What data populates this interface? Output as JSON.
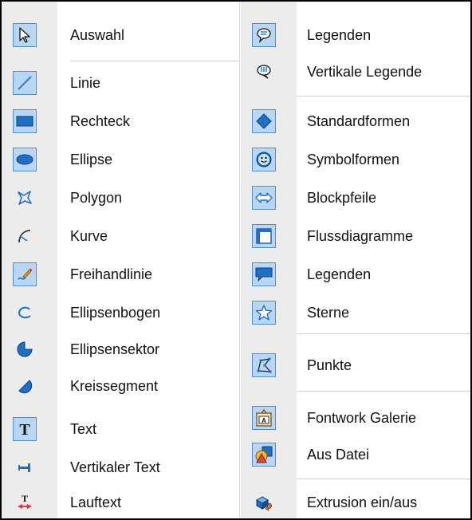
{
  "left_menu": [
    {
      "label": "Auswahl",
      "icon": "arrow-cursor-icon"
    },
    {
      "label": "Linie",
      "icon": "line-icon"
    },
    {
      "label": "Rechteck",
      "icon": "rectangle-icon"
    },
    {
      "label": "Ellipse",
      "icon": "ellipse-icon"
    },
    {
      "label": "Polygon",
      "icon": "polygon-icon"
    },
    {
      "label": "Kurve",
      "icon": "curve-icon"
    },
    {
      "label": "Freihandlinie",
      "icon": "pencil-icon"
    },
    {
      "label": "Ellipsenbogen",
      "icon": "arc-icon"
    },
    {
      "label": "Ellipsensektor",
      "icon": "sector-icon"
    },
    {
      "label": "Kreissegment",
      "icon": "segment-icon"
    },
    {
      "label": "Text",
      "icon": "text-icon"
    },
    {
      "label": "Vertikaler Text",
      "icon": "vertical-text-icon"
    },
    {
      "label": "Lauftext",
      "icon": "scrolling-text-icon"
    }
  ],
  "right_menu": [
    {
      "label": "Legenden",
      "icon": "callout-icon"
    },
    {
      "label": "Vertikale Legende",
      "icon": "vertical-callout-icon"
    },
    {
      "label": "Standardformen",
      "icon": "diamond-icon"
    },
    {
      "label": "Symbolformen",
      "icon": "smiley-icon"
    },
    {
      "label": "Blockpfeile",
      "icon": "double-arrow-icon"
    },
    {
      "label": "Flussdiagramme",
      "icon": "flowchart-icon"
    },
    {
      "label": "Legenden",
      "icon": "speech-bubble-icon"
    },
    {
      "label": "Sterne",
      "icon": "star-icon"
    },
    {
      "label": "Punkte",
      "icon": "points-icon"
    },
    {
      "label": "Fontwork Galerie",
      "icon": "fontwork-icon"
    },
    {
      "label": "Aus Datei",
      "icon": "from-file-icon"
    },
    {
      "label": "Extrusion ein/aus",
      "icon": "extrusion-icon"
    }
  ],
  "colors": {
    "highlight": "#b9d7f4",
    "highlight_border": "#4f8fc9",
    "icon_blue": "#1f6fc5",
    "icon_column": "#ececec"
  }
}
